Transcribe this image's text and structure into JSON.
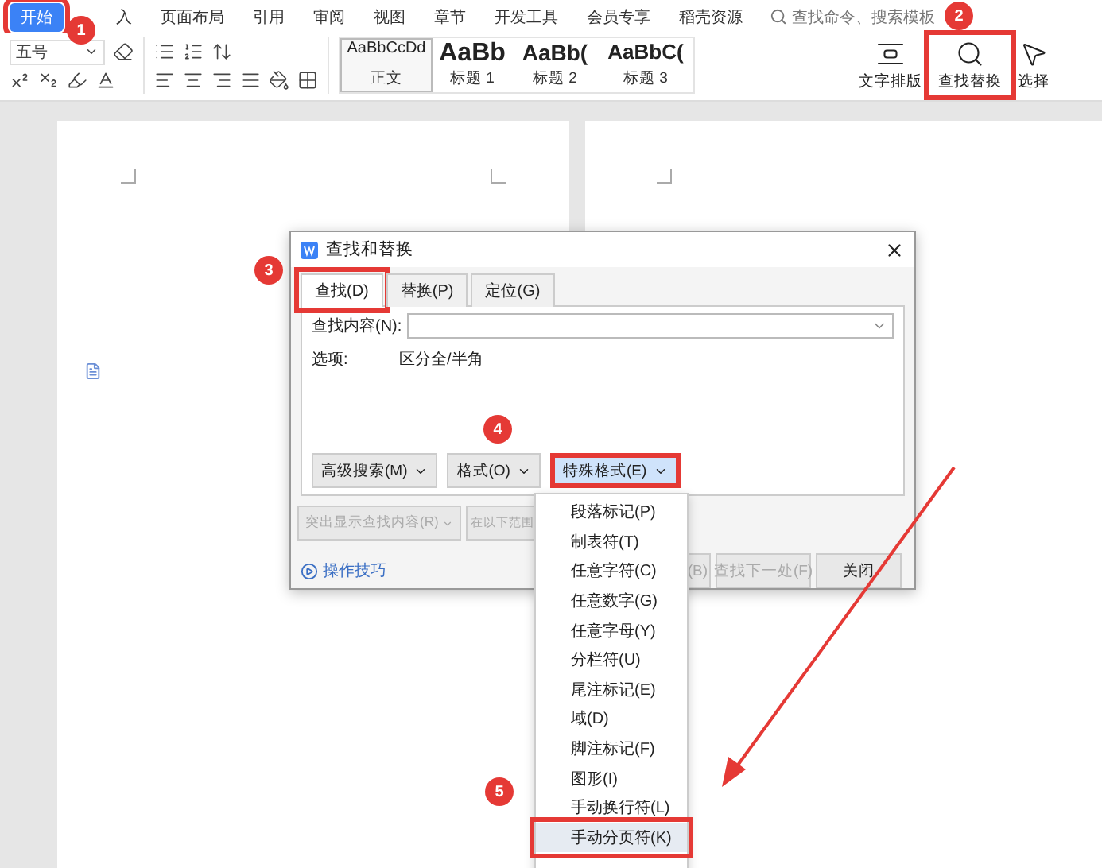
{
  "ribbon_tabs": [
    {
      "label": "开始",
      "selected": true,
      "highlighted": true
    },
    {
      "label": "入",
      "selected": false,
      "highlighted": false
    },
    {
      "label": "页面布局",
      "selected": false,
      "highlighted": false
    },
    {
      "label": "引用",
      "selected": false,
      "highlighted": false
    },
    {
      "label": "审阅",
      "selected": false,
      "highlighted": false
    },
    {
      "label": "视图",
      "selected": false,
      "highlighted": false
    },
    {
      "label": "章节",
      "selected": false,
      "highlighted": false
    },
    {
      "label": "开发工具",
      "selected": false,
      "highlighted": false
    },
    {
      "label": "会员专享",
      "selected": false,
      "highlighted": false
    },
    {
      "label": "稻壳资源",
      "selected": false,
      "highlighted": false
    }
  ],
  "search": {
    "placeholder": "查找命令、搜索模板"
  },
  "toolbar": {
    "font_size": "五号",
    "styles": [
      {
        "preview": "AaBbCcDd",
        "label": "正文",
        "selected": true
      },
      {
        "preview": "AaBb",
        "label": "标题 1",
        "selected": false
      },
      {
        "preview": "AaBb(",
        "label": "标题 2",
        "selected": false
      },
      {
        "preview": "AaBbC(",
        "label": "标题 3",
        "selected": false
      }
    ],
    "tools": [
      {
        "kind": "layout",
        "label": "文字排版",
        "highlighted": false
      },
      {
        "kind": "find",
        "label": "查找替换",
        "highlighted": true
      },
      {
        "kind": "select",
        "label": "选择",
        "highlighted": false
      }
    ]
  },
  "dialog": {
    "title": "查找和替换",
    "tabs": [
      {
        "label": "查找(D)",
        "selected": true,
        "highlighted": true
      },
      {
        "label": "替换(P)",
        "selected": false,
        "highlighted": false
      },
      {
        "label": "定位(G)",
        "selected": false,
        "highlighted": false
      }
    ],
    "find_label": "查找内容(N):",
    "options_label": "选项:",
    "options_value": "区分全/半角",
    "option_buttons": [
      {
        "label": "高级搜索(M)",
        "active": false,
        "highlighted": false
      },
      {
        "label": "格式(O)",
        "active": false,
        "highlighted": false
      },
      {
        "label": "特殊格式(E)",
        "active": true,
        "highlighted": true
      }
    ],
    "range_buttons": [
      {
        "label": "突出显示查找内容(R)",
        "disabled": true
      },
      {
        "label": "在以下范围",
        "disabled": true
      }
    ],
    "tips_link": "操作技巧",
    "action_buttons": [
      {
        "label": "(B)",
        "disabled": true
      },
      {
        "label": "查找下一处(F)",
        "disabled": true
      },
      {
        "label": "关闭",
        "disabled": false
      }
    ]
  },
  "menu": {
    "items": [
      {
        "label": "段落标记(P)",
        "selected": false
      },
      {
        "label": "制表符(T)",
        "selected": false
      },
      {
        "label": "任意字符(C)",
        "selected": false
      },
      {
        "label": "任意数字(G)",
        "selected": false
      },
      {
        "label": "任意字母(Y)",
        "selected": false
      },
      {
        "label": "分栏符(U)",
        "selected": false
      },
      {
        "label": "尾注标记(E)",
        "selected": false
      },
      {
        "label": "域(D)",
        "selected": false
      },
      {
        "label": "脚注标记(F)",
        "selected": false
      },
      {
        "label": "图形(I)",
        "selected": false
      },
      {
        "label": "手动换行符(L)",
        "selected": false
      },
      {
        "label": "手动分页符(K)",
        "selected": true
      }
    ]
  },
  "annotations": {
    "badges": [
      "1",
      "2",
      "3",
      "4",
      "5"
    ]
  }
}
